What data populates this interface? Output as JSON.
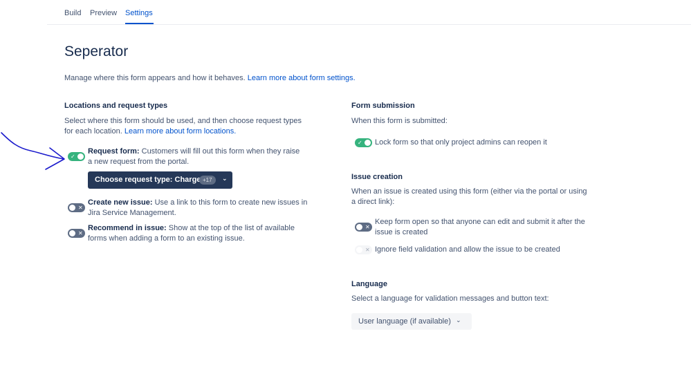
{
  "tabs": [
    {
      "label": "Build"
    },
    {
      "label": "Preview"
    },
    {
      "label": "Settings"
    }
  ],
  "title": "Seperator",
  "intro": {
    "text": "Manage where this form appears and how it behaves. ",
    "link": "Learn more about form settings."
  },
  "locations": {
    "heading": "Locations and request types",
    "desc_line1": "Select where this form should be used, and then choose request types",
    "desc_line2": "for each location. ",
    "desc_link": "Learn more about form locations.",
    "request_form": {
      "label": "Request form:",
      "line1": " Customers will fill out this form when they raise",
      "line2": "a new request from the portal.",
      "state": "on"
    },
    "request_type_button": {
      "label": "Choose request type: Charger",
      "badge": "+17"
    },
    "create_issue": {
      "label": "Create new issue:",
      "line1": " Use a link to this form to create new issues in",
      "line2": "Jira Service Management.",
      "state": "off"
    },
    "recommend_issue": {
      "label": "Recommend in issue:",
      "line1": " Show at the top of the list of available",
      "line2": "forms when adding a form to an existing issue.",
      "state": "off"
    }
  },
  "submission": {
    "heading": "Form submission",
    "desc": "When this form is submitted:",
    "lock": {
      "label": "Lock form so that only project admins can reopen it",
      "state": "on"
    }
  },
  "issue_creation": {
    "heading": "Issue creation",
    "desc_line1": "When an issue is created using this form (either via the portal or using",
    "desc_line2": "a direct link):",
    "keep_open": {
      "line1": "Keep form open so that anyone can edit and submit it after the",
      "line2": "issue is created",
      "state": "off"
    },
    "ignore_validation": {
      "label": "Ignore field validation and allow the issue to be created",
      "state": "disabled"
    }
  },
  "language": {
    "heading": "Language",
    "desc": "Select a language for validation messages and button text:",
    "selected": "User language (if available)"
  },
  "colors": {
    "accent": "#0052cc",
    "toggle_on": "#36b37e",
    "toggle_off": "#5e6c84",
    "annotation": "#1a1acc"
  },
  "icons": {
    "check": "✓",
    "cross": "✕",
    "chevron": "⌄"
  }
}
